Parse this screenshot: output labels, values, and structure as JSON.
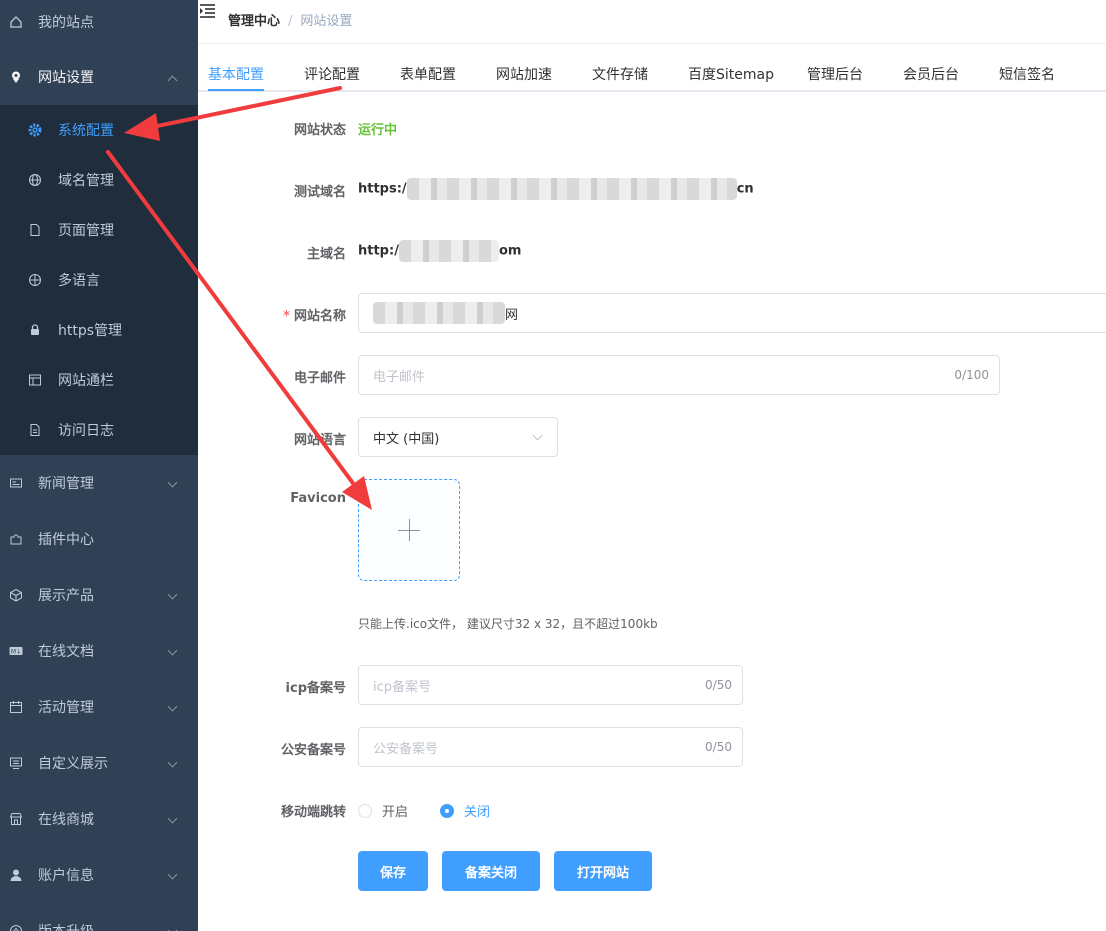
{
  "sidebar": {
    "top_item": {
      "label": "我的站点",
      "icon": "home-icon"
    },
    "site_settings": {
      "label": "网站设置",
      "icon": "location-icon",
      "expanded": true
    },
    "sub_items": [
      {
        "label": "系统配置",
        "icon": "gear-icon",
        "active": true
      },
      {
        "label": "域名管理",
        "icon": "globe-icon"
      },
      {
        "label": "页面管理",
        "icon": "document-icon"
      },
      {
        "label": "多语言",
        "icon": "language-icon"
      },
      {
        "label": "https管理",
        "icon": "lock-icon"
      },
      {
        "label": "网站通栏",
        "icon": "layout-icon"
      },
      {
        "label": "访问日志",
        "icon": "log-icon"
      }
    ],
    "items": [
      {
        "label": "新闻管理",
        "icon": "news-icon"
      },
      {
        "label": "插件中心",
        "icon": "puzzle-icon"
      },
      {
        "label": "展示产品",
        "icon": "box-icon"
      },
      {
        "label": "在线文档",
        "icon": "markdown-icon"
      },
      {
        "label": "活动管理",
        "icon": "calendar-icon"
      },
      {
        "label": "自定义展示",
        "icon": "display-icon"
      },
      {
        "label": "在线商城",
        "icon": "shop-icon"
      },
      {
        "label": "账户信息",
        "icon": "user-icon"
      },
      {
        "label": "版本升级",
        "icon": "upgrade-icon"
      }
    ]
  },
  "header": {
    "breadcrumb_main": "管理中心",
    "breadcrumb_sep": "/",
    "breadcrumb_current": "网站设置"
  },
  "tabs": [
    "基本配置",
    "评论配置",
    "表单配置",
    "网站加速",
    "文件存储",
    "百度Sitemap",
    "管理后台",
    "会员后台",
    "短信签名"
  ],
  "form": {
    "status_label": "网站状态",
    "status_value": "运行中",
    "test_domain_label": "测试域名",
    "test_domain_prefix": "https:/",
    "test_domain_suffix": "cn",
    "main_domain_label": "主域名",
    "main_domain_prefix": "http:/",
    "main_domain_suffix": "om",
    "site_name_label": "网站名称",
    "site_name_required": "*",
    "site_name_suffix": "网",
    "email_label": "电子邮件",
    "email_placeholder": "电子邮件",
    "email_count": "0/100",
    "language_label": "网站语言",
    "language_value": "中文 (中国)",
    "favicon_label": "Favicon",
    "favicon_tip": "只能上传.ico文件， 建议尺寸32 x 32，且不超过100kb",
    "icp_label": "icp备案号",
    "icp_placeholder": "icp备案号",
    "icp_count": "0/50",
    "police_label": "公安备案号",
    "police_placeholder": "公安备案号",
    "police_count": "0/50",
    "mobile_label": "移动端跳转",
    "mobile_on": "开启",
    "mobile_off": "关闭",
    "mobile_selected": "关闭"
  },
  "buttons": {
    "save": "保存",
    "record_close": "备案关闭",
    "open_site": "打开网站"
  },
  "colors": {
    "sidebar_bg": "#304156",
    "submenu_bg": "#1f2d3d",
    "accent": "#409eff",
    "success": "#67c23a",
    "annotation": "#f03c3c"
  }
}
